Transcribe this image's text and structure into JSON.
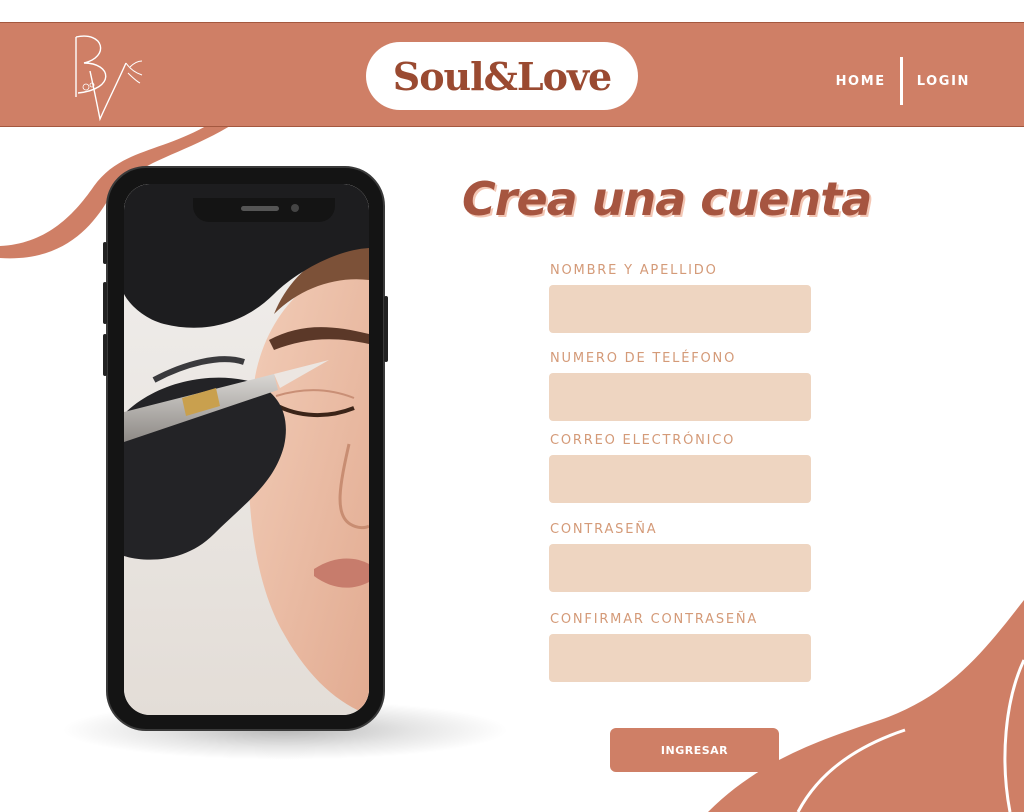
{
  "colors": {
    "accent": "#cf7f66",
    "brand_dark": "#9a4a31",
    "title": "#a65540",
    "label": "#d49a78",
    "input_bg": "#eed5c1",
    "white": "#ffffff"
  },
  "header": {
    "brand": "Soul&Love",
    "logo_icon": "bv-monogram-icon",
    "nav": {
      "home": "HOME",
      "login": "LOGIN"
    }
  },
  "hero": {
    "image": "phone-mockup-eyebrow-microblading-photo"
  },
  "form": {
    "title": "Crea una cuenta",
    "fields": [
      {
        "label": "NOMBRE Y APELLIDO",
        "value": ""
      },
      {
        "label": "NUMERO DE TELÉFONO",
        "value": ""
      },
      {
        "label": "CORREO ELECTRÓNICO",
        "value": ""
      },
      {
        "label": "CONTRASEÑA",
        "value": ""
      },
      {
        "label": "CONFIRMAR CONTRASEÑA",
        "value": ""
      }
    ],
    "submit_label": "INGRESAR"
  }
}
